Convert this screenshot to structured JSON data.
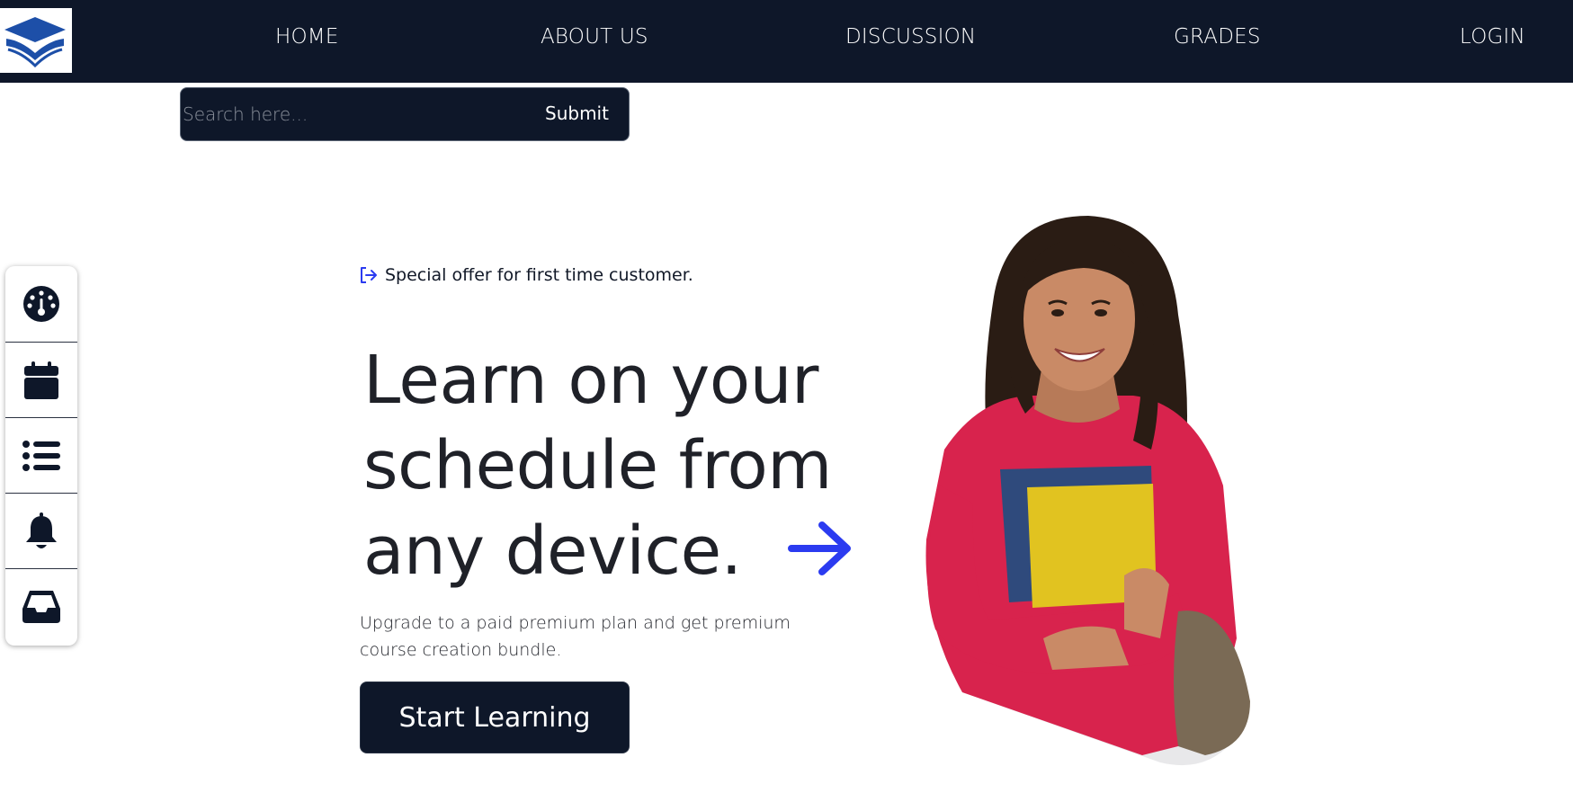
{
  "nav": {
    "logo_alt": "logo-icon",
    "links": [
      "HOME",
      "ABOUT US",
      "DISCUSSION",
      "GRADES",
      "LOGIN"
    ]
  },
  "search": {
    "placeholder": "Search here...",
    "value": "",
    "submit_label": "Submit"
  },
  "sidebar": {
    "items": [
      {
        "icon": "dashboard-icon"
      },
      {
        "icon": "calendar-icon"
      },
      {
        "icon": "list-icon"
      },
      {
        "icon": "bell-icon"
      },
      {
        "icon": "inbox-icon"
      }
    ]
  },
  "hero": {
    "offer_text": "Special offer for first time customer.",
    "headline_line1": "Learn on your",
    "headline_line2": "schedule from",
    "headline_line3": "any device.",
    "subtext": "Upgrade to a paid premium plan and get premium course creation bundle.",
    "cta_label": "Start Learning"
  },
  "colors": {
    "nav_bg": "#0e1729",
    "accent_blue": "#2b3bf0",
    "logo_blue": "#1d4fa8"
  }
}
